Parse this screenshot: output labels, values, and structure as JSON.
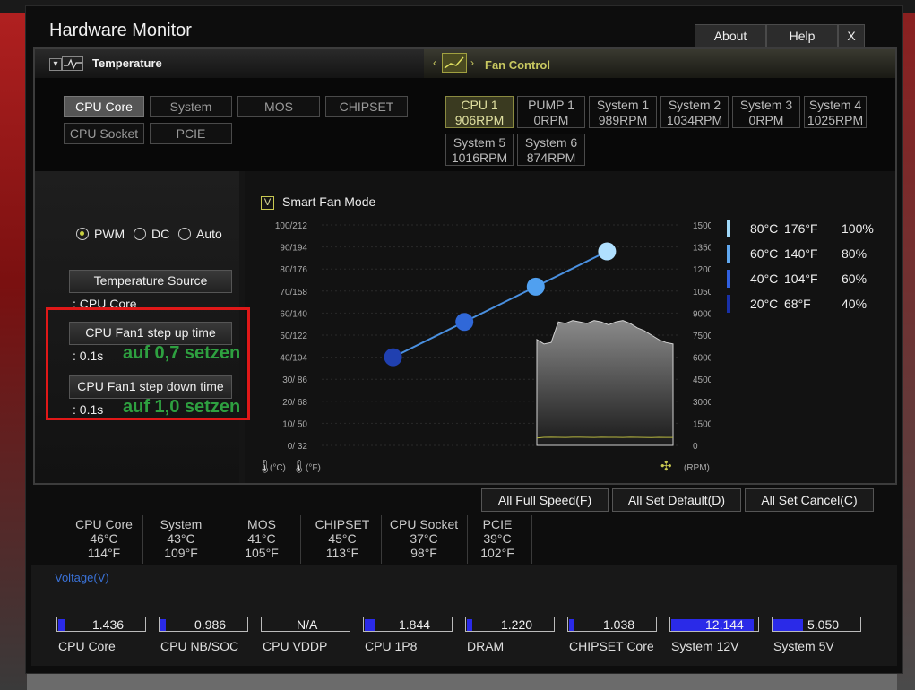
{
  "window": {
    "title": "Hardware Monitor"
  },
  "top_buttons": {
    "about": "About",
    "help": "Help",
    "close": "X"
  },
  "headers": {
    "temperature": "Temperature",
    "fan_control": "Fan Control"
  },
  "temp_sources": [
    "CPU Core",
    "System",
    "MOS",
    "CHIPSET",
    "CPU Socket",
    "PCIE"
  ],
  "temp_selected": "CPU Core",
  "fans": [
    {
      "name": "CPU 1",
      "rpm": "906RPM",
      "active": true
    },
    {
      "name": "PUMP 1",
      "rpm": "0RPM"
    },
    {
      "name": "System 1",
      "rpm": "989RPM"
    },
    {
      "name": "System 2",
      "rpm": "1034RPM"
    },
    {
      "name": "System 3",
      "rpm": "0RPM"
    },
    {
      "name": "System 4",
      "rpm": "1025RPM"
    },
    {
      "name": "System 5",
      "rpm": "1016RPM"
    },
    {
      "name": "System 6",
      "rpm": "874RPM"
    }
  ],
  "mode": {
    "pwm": "PWM",
    "dc": "DC",
    "auto": "Auto",
    "selected": "PWM"
  },
  "temp_source": {
    "button": "Temperature Source",
    "value": ": CPU Core"
  },
  "step_up": {
    "button": "CPU Fan1 step up time",
    "value": ": 0.1s",
    "annotation": "auf 0,7 setzen"
  },
  "step_down": {
    "button": "CPU Fan1 step down time",
    "value": ": 0.1s",
    "annotation": "auf 1,0 setzen"
  },
  "smart_fan": {
    "label": "Smart Fan Mode",
    "checked": true,
    "check_glyph": "V"
  },
  "legend": [
    {
      "c": "80°C",
      "f": "176°F",
      "pct": "100%",
      "color": "#a0d8f8"
    },
    {
      "c": "60°C",
      "f": "140°F",
      "pct": "80%",
      "color": "#60a8f0"
    },
    {
      "c": "40°C",
      "f": "104°F",
      "pct": "60%",
      "color": "#3060e0"
    },
    {
      "c": "20°C",
      "f": "68°F",
      "pct": "40%",
      "color": "#1830a8"
    }
  ],
  "chart_data": {
    "type": "line",
    "y_left_ticks": [
      "100/212",
      "90/194",
      "80/176",
      "70/158",
      "60/140",
      "50/122",
      "40/104",
      "30/ 86",
      "20/ 68",
      "10/ 50",
      "0/ 32"
    ],
    "y_right_ticks": [
      "15000",
      "13500",
      "12000",
      "10500",
      "9000",
      "7500",
      "6000",
      "4500",
      "3000",
      "1500",
      "0"
    ],
    "x_unit_left": "(°C)",
    "x_unit_right": "(°F)",
    "rpm_unit": "(RPM)",
    "series": [
      {
        "points": [
          {
            "temp": 20,
            "pct": 40
          },
          {
            "temp": 40,
            "pct": 56
          },
          {
            "temp": 60,
            "pct": 72
          },
          {
            "temp": 80,
            "pct": 88
          }
        ]
      }
    ],
    "fan_history_approx_rpm": [
      7200,
      6900,
      7000,
      8400,
      8300,
      8500,
      8400,
      8300,
      8500,
      8400,
      8200,
      8400,
      8500,
      8300,
      8000,
      7800,
      7500,
      7200,
      7000,
      6900
    ],
    "pump_history_approx_rpm": [
      500,
      550,
      560,
      550,
      540,
      560,
      560,
      550,
      540,
      560,
      550,
      550,
      540,
      560,
      550,
      540,
      530,
      550,
      540,
      540
    ]
  },
  "bottom_buttons": {
    "full_speed": "All Full Speed(F)",
    "set_default": "All Set Default(D)",
    "set_cancel": "All Set Cancel(C)"
  },
  "temps": [
    {
      "name": "CPU Core",
      "c": "46°C",
      "f": "114°F"
    },
    {
      "name": "System",
      "c": "43°C",
      "f": "109°F"
    },
    {
      "name": "MOS",
      "c": "41°C",
      "f": "105°F"
    },
    {
      "name": "CHIPSET",
      "c": "45°C",
      "f": "113°F"
    },
    {
      "name": "CPU Socket",
      "c": "37°C",
      "f": "98°F"
    },
    {
      "name": "PCIE",
      "c": "39°C",
      "f": "102°F"
    }
  ],
  "voltage": {
    "title": "Voltage(V)",
    "items": [
      {
        "label": "CPU Core",
        "value": "1.436",
        "level": 0.08
      },
      {
        "label": "CPU NB/SOC",
        "value": "0.986",
        "level": 0.06
      },
      {
        "label": "CPU VDDP",
        "value": "N/A",
        "level": 0
      },
      {
        "label": "CPU 1P8",
        "value": "1.844",
        "level": 0.12
      },
      {
        "label": "DRAM",
        "value": "1.220",
        "level": 0.06
      },
      {
        "label": "CHIPSET Core",
        "value": "1.038",
        "level": 0.06
      },
      {
        "label": "System 12V",
        "value": "12.144",
        "level": 0.96
      },
      {
        "label": "System 5V",
        "value": "5.050",
        "level": 0.34
      }
    ]
  }
}
